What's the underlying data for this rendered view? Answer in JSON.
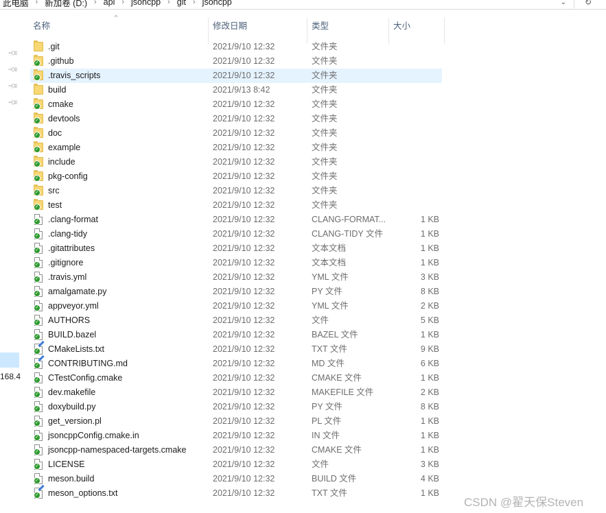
{
  "address_bar": {
    "crumbs": [
      "此电脑",
      "新加卷 (D:)",
      "api",
      "jsoncpp",
      "git",
      "jsoncpp"
    ],
    "separator_icon": "chevron-right-icon",
    "dropdown_icon": "chevron-down-icon",
    "refresh_icon": "refresh-icon"
  },
  "nav_pane": {
    "pin_icon": "pin-icon",
    "pinned_count": 4,
    "cut_text": "168.4"
  },
  "columns": {
    "name": "名称",
    "date": "修改日期",
    "type": "类型",
    "size": "大小",
    "sort_indicator": "^"
  },
  "rows": [
    {
      "name": ".git",
      "date": "2021/9/10 12:32",
      "type": "文件夹",
      "size": "",
      "icon": "folder-icon",
      "status": "none"
    },
    {
      "name": ".github",
      "date": "2021/9/10 12:32",
      "type": "文件夹",
      "size": "",
      "icon": "folder-icon",
      "status": "synced"
    },
    {
      "name": ".travis_scripts",
      "date": "2021/9/10 12:32",
      "type": "文件夹",
      "size": "",
      "icon": "folder-icon",
      "status": "synced",
      "selected": true
    },
    {
      "name": "build",
      "date": "2021/9/13 8:42",
      "type": "文件夹",
      "size": "",
      "icon": "folder-icon",
      "status": "none"
    },
    {
      "name": "cmake",
      "date": "2021/9/10 12:32",
      "type": "文件夹",
      "size": "",
      "icon": "folder-icon",
      "status": "synced"
    },
    {
      "name": "devtools",
      "date": "2021/9/10 12:32",
      "type": "文件夹",
      "size": "",
      "icon": "folder-icon",
      "status": "synced"
    },
    {
      "name": "doc",
      "date": "2021/9/10 12:32",
      "type": "文件夹",
      "size": "",
      "icon": "folder-icon",
      "status": "synced"
    },
    {
      "name": "example",
      "date": "2021/9/10 12:32",
      "type": "文件夹",
      "size": "",
      "icon": "folder-icon",
      "status": "synced"
    },
    {
      "name": "include",
      "date": "2021/9/10 12:32",
      "type": "文件夹",
      "size": "",
      "icon": "folder-icon",
      "status": "synced"
    },
    {
      "name": "pkg-config",
      "date": "2021/9/10 12:32",
      "type": "文件夹",
      "size": "",
      "icon": "folder-icon",
      "status": "synced"
    },
    {
      "name": "src",
      "date": "2021/9/10 12:32",
      "type": "文件夹",
      "size": "",
      "icon": "folder-icon",
      "status": "synced"
    },
    {
      "name": "test",
      "date": "2021/9/10 12:32",
      "type": "文件夹",
      "size": "",
      "icon": "folder-icon",
      "status": "synced"
    },
    {
      "name": ".clang-format",
      "date": "2021/9/10 12:32",
      "type": "CLANG-FORMAT...",
      "size": "1 KB",
      "icon": "file-icon",
      "status": "synced"
    },
    {
      "name": ".clang-tidy",
      "date": "2021/9/10 12:32",
      "type": "CLANG-TIDY 文件",
      "size": "1 KB",
      "icon": "file-icon",
      "status": "synced"
    },
    {
      "name": ".gitattributes",
      "date": "2021/9/10 12:32",
      "type": "文本文档",
      "size": "1 KB",
      "icon": "file-icon",
      "status": "synced"
    },
    {
      "name": ".gitignore",
      "date": "2021/9/10 12:32",
      "type": "文本文档",
      "size": "1 KB",
      "icon": "file-icon",
      "status": "synced"
    },
    {
      "name": ".travis.yml",
      "date": "2021/9/10 12:32",
      "type": "YML 文件",
      "size": "3 KB",
      "icon": "file-icon",
      "status": "synced"
    },
    {
      "name": "amalgamate.py",
      "date": "2021/9/10 12:32",
      "type": "PY 文件",
      "size": "8 KB",
      "icon": "file-icon",
      "status": "synced"
    },
    {
      "name": "appveyor.yml",
      "date": "2021/9/10 12:32",
      "type": "YML 文件",
      "size": "2 KB",
      "icon": "file-icon",
      "status": "synced"
    },
    {
      "name": "AUTHORS",
      "date": "2021/9/10 12:32",
      "type": "文件",
      "size": "5 KB",
      "icon": "file-icon",
      "status": "synced"
    },
    {
      "name": "BUILD.bazel",
      "date": "2021/9/10 12:32",
      "type": "BAZEL 文件",
      "size": "1 KB",
      "icon": "file-icon",
      "status": "synced"
    },
    {
      "name": "CMakeLists.txt",
      "date": "2021/9/10 12:32",
      "type": "TXT 文件",
      "size": "9 KB",
      "icon": "edited-file-icon",
      "status": "synced"
    },
    {
      "name": "CONTRIBUTING.md",
      "date": "2021/9/10 12:32",
      "type": "MD 文件",
      "size": "6 KB",
      "icon": "edited-file-icon",
      "status": "synced"
    },
    {
      "name": "CTestConfig.cmake",
      "date": "2021/9/10 12:32",
      "type": "CMAKE 文件",
      "size": "1 KB",
      "icon": "file-icon",
      "status": "synced"
    },
    {
      "name": "dev.makefile",
      "date": "2021/9/10 12:32",
      "type": "MAKEFILE 文件",
      "size": "2 KB",
      "icon": "file-icon",
      "status": "synced"
    },
    {
      "name": "doxybuild.py",
      "date": "2021/9/10 12:32",
      "type": "PY 文件",
      "size": "8 KB",
      "icon": "file-icon",
      "status": "synced"
    },
    {
      "name": "get_version.pl",
      "date": "2021/9/10 12:32",
      "type": "PL 文件",
      "size": "1 KB",
      "icon": "file-icon",
      "status": "synced"
    },
    {
      "name": "jsoncppConfig.cmake.in",
      "date": "2021/9/10 12:32",
      "type": "IN 文件",
      "size": "1 KB",
      "icon": "file-icon",
      "status": "synced"
    },
    {
      "name": "jsoncpp-namespaced-targets.cmake",
      "date": "2021/9/10 12:32",
      "type": "CMAKE 文件",
      "size": "1 KB",
      "icon": "file-icon",
      "status": "synced"
    },
    {
      "name": "LICENSE",
      "date": "2021/9/10 12:32",
      "type": "文件",
      "size": "3 KB",
      "icon": "file-icon",
      "status": "synced"
    },
    {
      "name": "meson.build",
      "date": "2021/9/10 12:32",
      "type": "BUILD 文件",
      "size": "4 KB",
      "icon": "file-icon",
      "status": "synced"
    },
    {
      "name": "meson_options.txt",
      "date": "2021/9/10 12:32",
      "type": "TXT 文件",
      "size": "1 KB",
      "icon": "edited-file-icon",
      "status": "synced"
    }
  ],
  "watermark": "CSDN @翟天保Steven",
  "colors": {
    "selected_row": "#e5f3ff",
    "header_text": "#4c607a",
    "folder": "#f8d775",
    "sync_badge": "#2f9a2f"
  }
}
